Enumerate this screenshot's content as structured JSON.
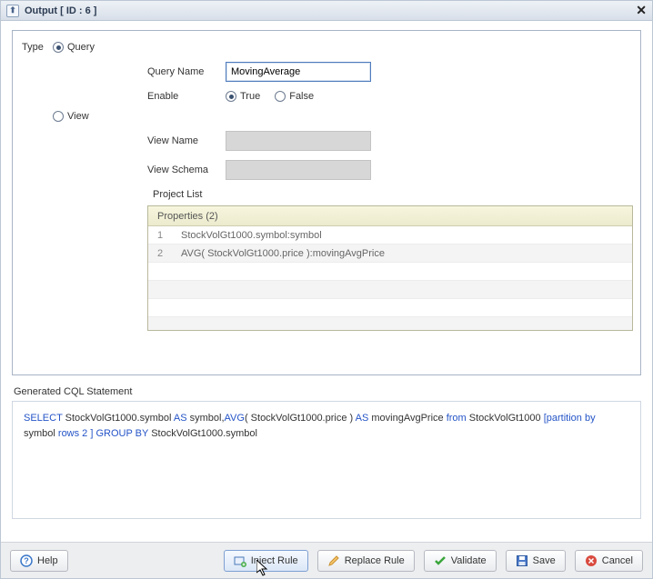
{
  "title": "Output [ ID : 6 ]",
  "type_label": "Type",
  "radios": {
    "query": "Query",
    "view": "View",
    "true": "True",
    "false": "False"
  },
  "query_section": {
    "name_label": "Query Name",
    "name_value": "MovingAverage",
    "enable_label": "Enable"
  },
  "view_section": {
    "name_label": "View Name",
    "schema_label": "View Schema"
  },
  "project_list": {
    "label": "Project List",
    "header": "Properties (2)",
    "rows": [
      {
        "idx": "1",
        "text": "StockVolGt1000.symbol:symbol"
      },
      {
        "idx": "2",
        "text": "AVG( StockVolGt1000.price ):movingAvgPrice"
      }
    ]
  },
  "cql": {
    "label": "Generated CQL Statement",
    "tokens": [
      {
        "t": "SELECT ",
        "k": true
      },
      {
        "t": "StockVolGt1000.symbol ",
        "k": false
      },
      {
        "t": "AS ",
        "k": true
      },
      {
        "t": "symbol,",
        "k": false
      },
      {
        "t": "AVG",
        "k": true
      },
      {
        "t": "( StockVolGt1000.price ) ",
        "k": false
      },
      {
        "t": "AS ",
        "k": true
      },
      {
        "t": "movingAvgPrice ",
        "k": false
      },
      {
        "t": "from  ",
        "k": true
      },
      {
        "t": "StockVolGt1000  ",
        "k": false
      },
      {
        "t": "[partition by  ",
        "k": true
      },
      {
        "t": "symbol  ",
        "k": false
      },
      {
        "t": "rows 2 ] GROUP BY ",
        "k": true
      },
      {
        "t": "StockVolGt1000.symbol",
        "k": false
      }
    ]
  },
  "buttons": {
    "help": "Help",
    "inject": "Inject Rule",
    "replace": "Replace Rule",
    "validate": "Validate",
    "save": "Save",
    "cancel": "Cancel"
  }
}
